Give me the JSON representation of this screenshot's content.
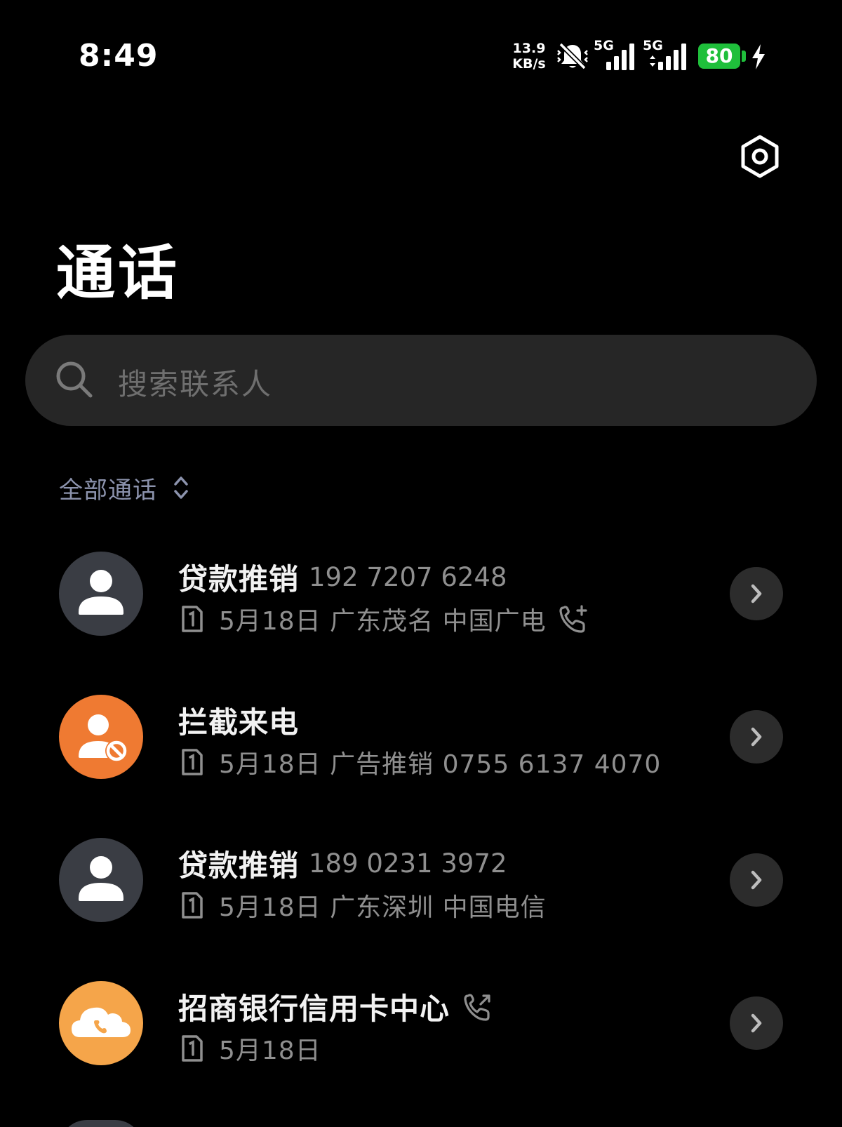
{
  "status_bar": {
    "time": "8:49",
    "net_speed_value": "13.9",
    "net_speed_unit": "KB/s",
    "sim1_network": "5G",
    "sim2_network": "5G",
    "battery_level": "80",
    "battery_color": "#1fbf3b",
    "icons": [
      "bell-off-icon",
      "signal-icon",
      "signal-icon",
      "battery-icon",
      "charging-bolt-icon"
    ]
  },
  "header": {
    "title": "通话",
    "settings_icon": "settings-hex-icon"
  },
  "search": {
    "placeholder": "搜索联系人",
    "icon": "search-icon"
  },
  "filter": {
    "label": "全部通话",
    "icon": "sort-toggle-icon"
  },
  "calls": [
    {
      "name": "贷款推销",
      "number": "192 7207 6248",
      "detail": "5月18日 广东茂名 中国广电",
      "avatar_type": "person",
      "avatar_color": "#3a3d44",
      "sim": "1",
      "trailing_icon": "incoming-call-icon"
    },
    {
      "name": "拦截来电",
      "number": "",
      "detail": "5月18日 广告推销 0755 6137 4070",
      "avatar_type": "blocked",
      "avatar_color": "#ef7a32",
      "sim": "1",
      "trailing_icon": ""
    },
    {
      "name": "贷款推销",
      "number": "189 0231 3972",
      "detail": "5月18日 广东深圳 中国电信",
      "avatar_type": "person",
      "avatar_color": "#3a3d44",
      "sim": "1",
      "trailing_icon": ""
    },
    {
      "name": "招商银行信用卡中心",
      "number": "",
      "detail": "5月18日",
      "avatar_type": "cloud-phone",
      "avatar_color": "#f5a54a",
      "sim": "1",
      "trailing_icon": "outgoing-call-icon"
    }
  ]
}
